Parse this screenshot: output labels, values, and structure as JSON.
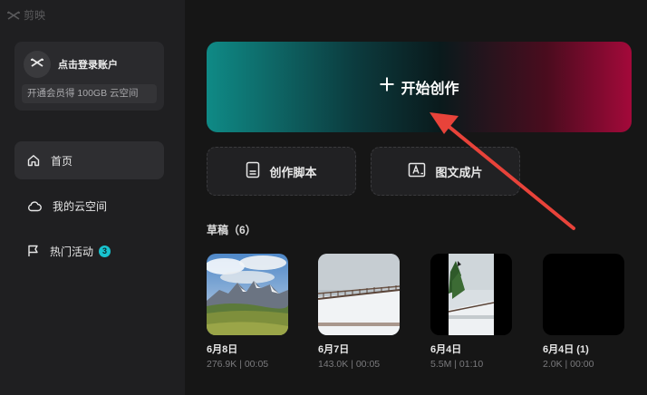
{
  "app": {
    "title": "剪映",
    "logo_icon": "capcut-logo-icon"
  },
  "account": {
    "login_text": "点击登录账户",
    "vip_text": "开通会员得 100GB 云空间"
  },
  "sidebar": {
    "items": [
      {
        "label": "首页",
        "icon": "home-icon",
        "active": true
      },
      {
        "label": "我的云空间",
        "icon": "cloud-icon",
        "active": false
      },
      {
        "label": "热门活动",
        "icon": "flag-icon",
        "active": false,
        "badge": "3"
      }
    ]
  },
  "main": {
    "create_label": "开始创作",
    "script_label": "创作脚本",
    "image_text_label": "图文成片",
    "drafts_title": "草稿（6）",
    "drafts": [
      {
        "date": "6月8日",
        "meta": "276.9K | 00:05",
        "thumb": "mountain-landscape"
      },
      {
        "date": "6月7日",
        "meta": "143.0K | 00:05",
        "thumb": "snowy-fence"
      },
      {
        "date": "6月4日",
        "meta": "5.5M | 01:10",
        "thumb": "snowy-tree-portrait"
      },
      {
        "date": "6月4日 (1)",
        "meta": "2.0K | 00:00",
        "thumb": "black"
      }
    ]
  },
  "colors": {
    "gradient_start": "#0f8a86",
    "gradient_end": "#a3093a",
    "badge": "#18c3cf",
    "annotation_arrow": "#e8433a"
  }
}
